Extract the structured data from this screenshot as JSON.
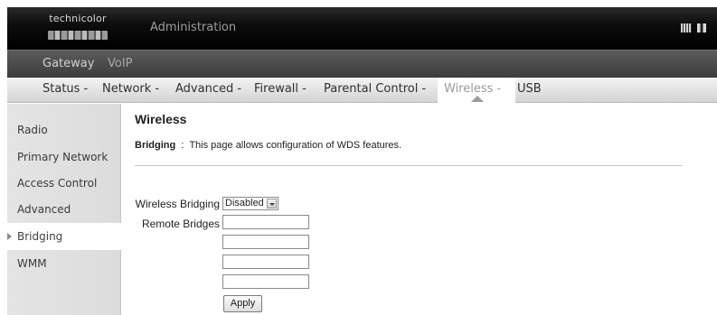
{
  "header": {
    "logo_text": "technicolor",
    "title": "Administration",
    "lang_icons": [
      "flag-icon",
      "flag-icon"
    ]
  },
  "subnav": {
    "items": [
      {
        "label": "Gateway"
      },
      {
        "label": "VoIP"
      }
    ]
  },
  "mainnav": {
    "items": [
      {
        "label": "Status -"
      },
      {
        "label": "Network -"
      },
      {
        "label": "Advanced -"
      },
      {
        "label": "Firewall -"
      },
      {
        "label": "Parental Control -"
      },
      {
        "label": "Wireless -"
      },
      {
        "label": "USB"
      }
    ],
    "active": "Wireless -"
  },
  "sidebar": {
    "items": [
      {
        "label": "Radio"
      },
      {
        "label": "Primary Network"
      },
      {
        "label": "Access Control"
      },
      {
        "label": "Advanced"
      },
      {
        "label": "Bridging"
      },
      {
        "label": "WMM"
      }
    ],
    "active": "Bridging"
  },
  "content": {
    "title": "Wireless",
    "desc_bold": "Bridging",
    "desc_sep": ":",
    "desc_text": "This page allows configuration of WDS features.",
    "bridging_label": "Wireless Bridging",
    "bridging_value": "Disabled",
    "remote_label": "Remote Bridges",
    "remote_values": [
      "",
      "",
      "",
      ""
    ],
    "apply_label": "Apply"
  },
  "colors": {
    "header_bg": "#000000",
    "subnav_bg": "#4a4a4a",
    "nav_bg": "#e2e2e2",
    "sidebar_bg": "#e0e0e0"
  }
}
